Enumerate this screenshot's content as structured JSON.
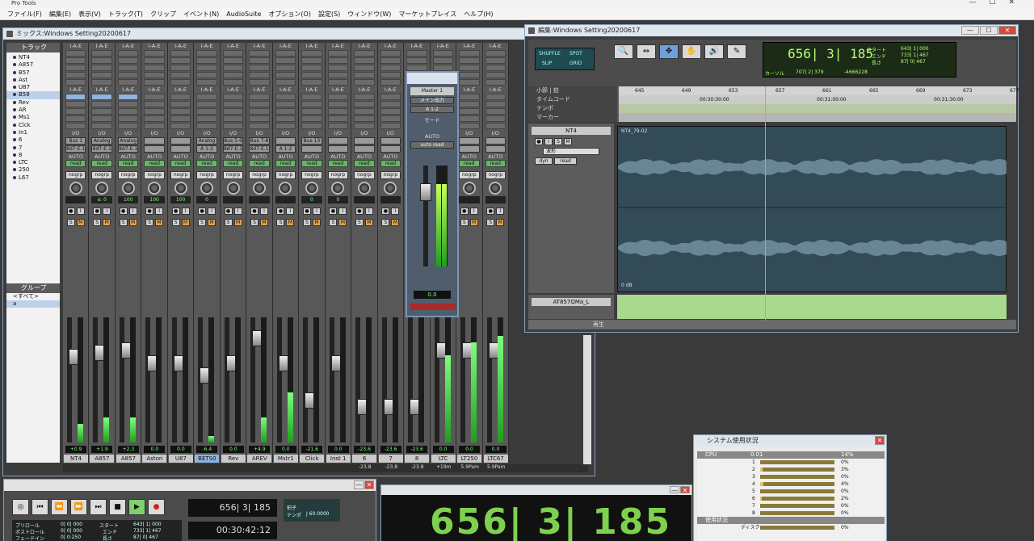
{
  "app": {
    "title": "Pro Tools"
  },
  "menu": [
    "ファイル(F)",
    "編集(E)",
    "表示(V)",
    "トラック(T)",
    "クリップ",
    "イベント(N)",
    "AudioSuite",
    "オプション(O)",
    "設定(S)",
    "ウィンドウ(W)",
    "マーケットプレイス",
    "ヘルプ(H)"
  ],
  "mix": {
    "title": "ミックス:Windows Setting20200617",
    "tracks_header": "トラック",
    "tracks": [
      "NT4",
      "A857",
      "B57",
      "Ast",
      "U87",
      "B58",
      "Rev",
      "AR",
      "Ms1",
      "Clck",
      "In1",
      "6",
      "7",
      "8",
      "LTC",
      "250",
      "L67"
    ],
    "groups_header": "グループ",
    "groups": [
      "<すべて>",
      "a"
    ],
    "io_label": "I/O",
    "auto_label": "AUTO",
    "read_label": "read",
    "nogrp_label": "nogrp",
    "strips": [
      {
        "name": "NT4",
        "slot": "I-A-E",
        "io": "Bus 1",
        "out": "8d7-E.1",
        "vol": "+0.9",
        "pan": "",
        "level": 0.15,
        "fader": 0.25
      },
      {
        "name": "A857",
        "slot": "I-A-E",
        "io": "Analog 2",
        "out": "8d7-E.1",
        "vol": "+1.9",
        "pan": "a: 0",
        "level": 0.2,
        "fader": 0.22
      },
      {
        "name": "A857",
        "slot": "I-A-E",
        "io": "Analog 3",
        "out": "8d7-E.1",
        "vol": "+2.3",
        "pan": "100",
        "level": 0.2,
        "fader": 0.2
      },
      {
        "name": "Aston",
        "slot": "I-A-E",
        "io": "",
        "out": "",
        "vol": "0.0",
        "pan": "100",
        "level": 0,
        "fader": 0.3
      },
      {
        "name": "U87",
        "slot": "I-A-E",
        "io": "",
        "out": "",
        "vol": "0.0",
        "pan": "100",
        "level": 0,
        "fader": 0.3
      },
      {
        "name": "BETS0",
        "slot": "I-A-E",
        "io": "Analog 1",
        "out": "A 1-2",
        "vol": "-6.4",
        "pan": "0",
        "level": 0.05,
        "fader": 0.4
      },
      {
        "name": "Rev",
        "slot": "I-A-E",
        "io": "Bus 5-6",
        "out": "8d7-E.1",
        "vol": "0.0",
        "pan": "",
        "level": 0,
        "fader": 0.3
      },
      {
        "name": "AREV",
        "slot": "I-A-E",
        "io": "Bus 7-8",
        "out": "8d7-E.1",
        "vol": "+4.9",
        "pan": "",
        "level": 0.2,
        "fader": 0.1
      },
      {
        "name": "Mstr1",
        "slot": "I-A-E",
        "io": "",
        "out": "A 1-2",
        "vol": "0.0",
        "pan": "",
        "level": 0.4,
        "fader": 0.3
      },
      {
        "name": "Click",
        "slot": "I-A-E",
        "io": "Bus 13",
        "out": "",
        "vol": "-21.6",
        "pan": "0",
        "level": 0,
        "fader": 0.6
      },
      {
        "name": "Inst 1",
        "slot": "I-A-E",
        "io": "",
        "out": "",
        "vol": "0.0",
        "pan": "0",
        "level": 0,
        "fader": 0.3
      },
      {
        "name": "6",
        "slot": "I-A-E",
        "io": "",
        "out": "",
        "vol": "-23.6",
        "pan": "",
        "level": 0,
        "fader": 0.65
      },
      {
        "name": "7",
        "slot": "I-A-E",
        "io": "",
        "out": "",
        "vol": "-23.6",
        "pan": "",
        "level": 0,
        "fader": 0.65
      },
      {
        "name": "8",
        "slot": "I-A-E",
        "io": "",
        "out": "",
        "vol": "-23.6",
        "pan": "",
        "level": 0,
        "fader": 0.65
      },
      {
        "name": "LTC",
        "slot": "I-A-E",
        "io": "",
        "out": "",
        "vol": "0.0",
        "pan": "",
        "level": 0.7,
        "fader": 0.2
      },
      {
        "name": "LT250",
        "slot": "I-A-E",
        "io": "",
        "out": "",
        "vol": "0.0",
        "pan": "",
        "level": 0.8,
        "fader": 0.2
      },
      {
        "name": "LTC67",
        "slot": "I-A-E",
        "io": "",
        "out": "",
        "vol": "0.0",
        "pan": "",
        "level": 0.85,
        "fader": 0.2
      }
    ],
    "footer": [
      "",
      "",
      "",
      "",
      "",
      "",
      "",
      "",
      "",
      "",
      "",
      "-23.8",
      "-23.8",
      "-23.8",
      "+19m",
      "5.9Pam",
      "5.9Pam"
    ]
  },
  "master": {
    "name": "Master 1",
    "bypass": "メイン出力",
    "out": "A 1-2",
    "mode": "モード",
    "auto_label": "AUTO",
    "auto_mode": "auto read",
    "vol": "0.0",
    "level": 0.82
  },
  "edit": {
    "title": "編集:Windows Setting20200617",
    "mode_slip": "SLIP",
    "mode_grid": "GRID",
    "mode_shuffle": "SHUFFLE",
    "mode_spot": "SPOT",
    "tools": [
      "🔍",
      "⇔",
      "✥",
      "✋",
      "🔊",
      "✎"
    ],
    "counter_main": "656| 3| 185",
    "start_label": "スタート",
    "end_label": "エンド",
    "length_label": "長さ",
    "start_val": "643| 1| 000",
    "end_val": "733| 1| 467",
    "length_val": "87| 0| 467",
    "cursor_label": "カーソル",
    "cursor_val": "707| 2| 379",
    "cursor_extra": "-4666228",
    "ruler_rows": [
      "小節 | 拍",
      "タイムコード",
      "テンポ",
      "マーカー"
    ],
    "bars": [
      "645",
      "649",
      "653",
      "657",
      "661",
      "665",
      "669",
      "673",
      "677"
    ],
    "timecode": [
      "00:30:30:00",
      "00:31:00:00",
      "00:31:30:00"
    ],
    "track1": "NT4",
    "track1_dd": "波形",
    "track1_dyn": "dyn",
    "track1_read": "read",
    "clip_name": "NT4_79-02",
    "db_label": "0 dB",
    "track2": "AT857QMa_L",
    "footer": "再生"
  },
  "sys": {
    "title": "システム使用状況",
    "cpu_label": "CPU",
    "cpu_val": "0.01",
    "cpu_pct": "14%",
    "rows": [
      {
        "n": "1",
        "pct": "0%",
        "v": 0.0
      },
      {
        "n": "2",
        "pct": "3%",
        "v": 0.03
      },
      {
        "n": "3",
        "pct": "0%",
        "v": 0.0
      },
      {
        "n": "4",
        "pct": "4%",
        "v": 0.04
      },
      {
        "n": "5",
        "pct": "0%",
        "v": 0.0
      },
      {
        "n": "6",
        "pct": "2%",
        "v": 0.02
      },
      {
        "n": "7",
        "pct": "0%",
        "v": 0.0
      },
      {
        "n": "8",
        "pct": "0%",
        "v": 0.0
      }
    ],
    "usage_label": "使用状況",
    "disk_label": "ディスク",
    "disk_pct": "0%"
  },
  "transport": {
    "counter1": "656| 3| 185",
    "counter2": "00:30:42:12",
    "pre_roll": "プリロール",
    "post_roll": "ポストロール",
    "fade_in": "フェードイン",
    "pre_val": "0| 0| 000",
    "post_val": "0| 0| 000",
    "fade_val": "0| 0:250",
    "start_label": "スタート",
    "end_label": "エンド",
    "length_label": "長さ",
    "start_val": "643| 1| 000",
    "end_val": "733| 1| 467",
    "length_val": "87| 0| 467",
    "tempo_label": "テンポ",
    "meter_label": "拍子",
    "tempo_val": "J 60.0000"
  },
  "big_counter": "656| 3| 185"
}
